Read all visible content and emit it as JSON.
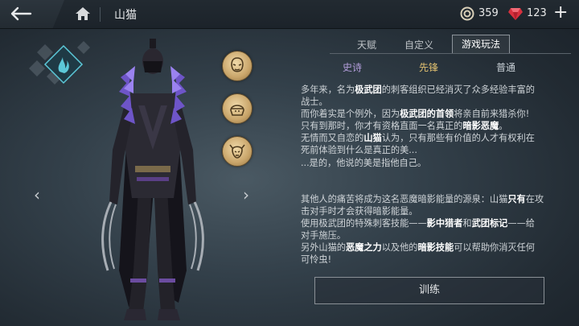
{
  "header": {
    "hero_name": "山猫",
    "coins": "359",
    "gems": "123",
    "plus": "+"
  },
  "tabs": [
    "天赋",
    "自定义",
    "游戏玩法"
  ],
  "active_tab": "游戏玩法",
  "subtabs": [
    {
      "label": "史诗",
      "color": "#b39ddb"
    },
    {
      "label": "先锋",
      "color": "#e0c070"
    },
    {
      "label": "普通",
      "color": "#c8d0d6"
    }
  ],
  "nav": {
    "left": "‹",
    "right": "›"
  },
  "description": {
    "p1": [
      {
        "t": "多年来，名为"
      },
      {
        "b": "极武团"
      },
      {
        "t": "的刺客组织已经消灭了众多经验丰富的"
      }
    ],
    "p1b": "战士。",
    "p2a": [
      {
        "t": "而你着实是个例外，因为"
      },
      {
        "b": "极武团的首领"
      },
      {
        "t": "将亲自前来猎杀你!"
      }
    ],
    "p2b": [
      {
        "t": "只有到那时，你才有资格直面一名真正的"
      },
      {
        "b": "暗影恶魔"
      },
      {
        "t": "。"
      }
    ],
    "p3a": [
      {
        "t": "无情而又自恋的"
      },
      {
        "b": "山猫"
      },
      {
        "t": "认为，只有那些有价值的人才有权利在"
      }
    ],
    "p3b": "死前体验到什么是真正的美...",
    "p3c": "...是的，他说的美是指他自己。",
    "p4a": [
      {
        "t": "其他人的痛苦将成为这名恶魔暗影能量的源泉：山猫"
      },
      {
        "b": "只有"
      },
      {
        "t": "在攻"
      }
    ],
    "p4b": "击对手时才会获得暗影能量。",
    "p5a": [
      {
        "t": "使用极武团的特殊刺客技能——"
      },
      {
        "b": "影中猎者"
      },
      {
        "t": "和"
      },
      {
        "b": "武团标记"
      },
      {
        "t": "——给"
      }
    ],
    "p5b": "对手施压。",
    "p6a": [
      {
        "t": "另外山猫的"
      },
      {
        "b": "恶魔之力"
      },
      {
        "t": "以及他的"
      },
      {
        "b": "暗影技能"
      },
      {
        "t": "可以帮助你消灭任何"
      }
    ],
    "p6b": "可怜虫!"
  },
  "train_button": "训练",
  "icons": {
    "back": "back-arrow-icon",
    "home": "home-icon",
    "coin": "coin-icon",
    "gem": "ruby-gem-icon",
    "class": "shadow-flame-class-icon",
    "medal_1": "mask-face-icon",
    "medal_2": "helmet-icon",
    "medal_3": "demon-skull-icon"
  },
  "colors": {
    "epic": "#b39ddb",
    "vanguard": "#e0c070",
    "common": "#c8d0d6",
    "gem": "#e03a4a",
    "class_cyan": "#5cc8d8"
  }
}
